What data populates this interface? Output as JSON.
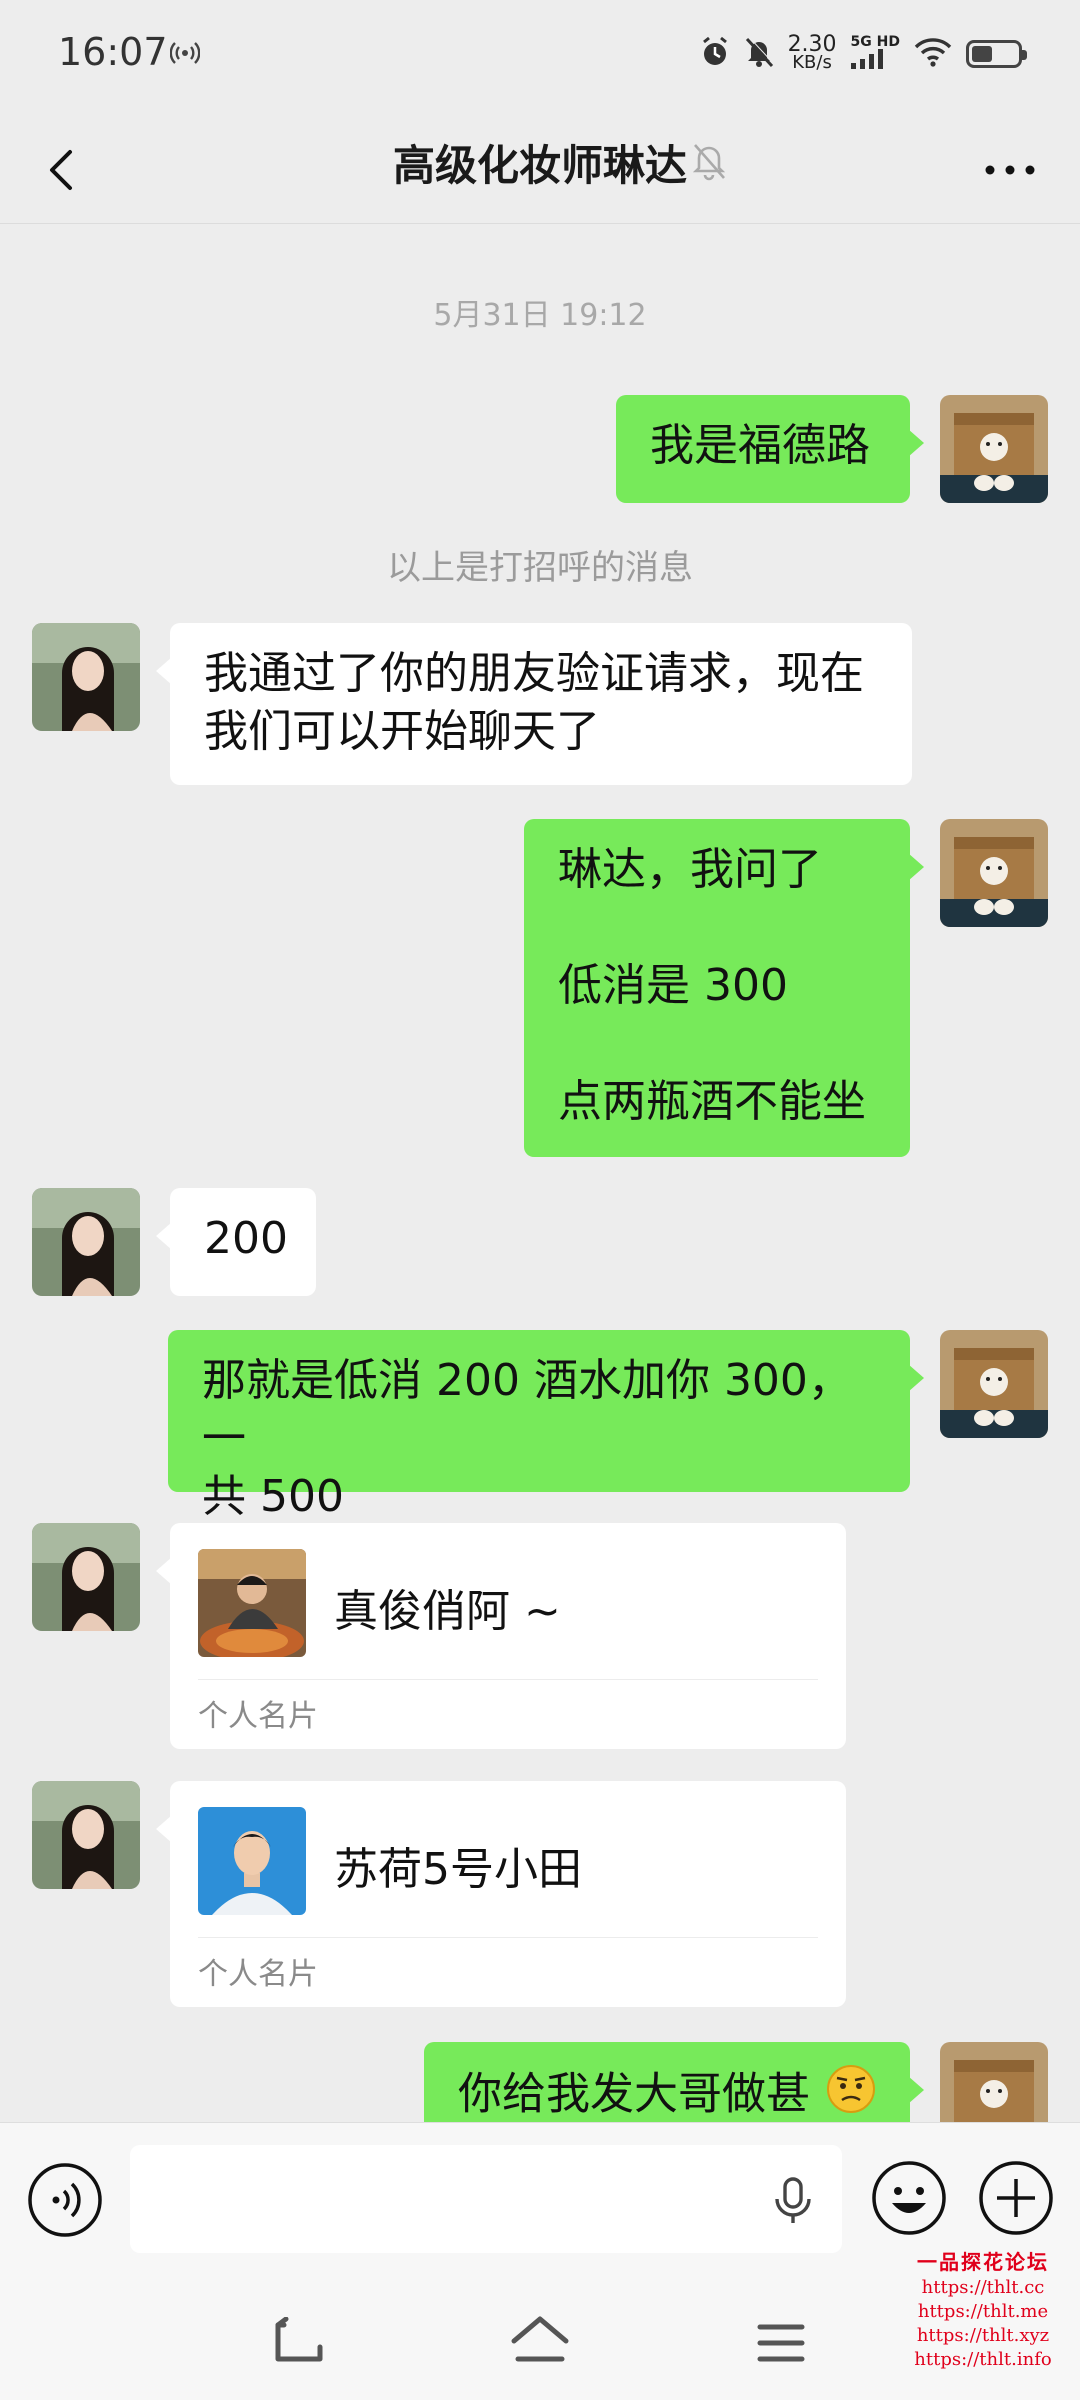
{
  "status_bar": {
    "time": "16:07",
    "net_speed_value": "2.30",
    "net_speed_unit": "KB/s",
    "network_label": "5G HD",
    "icons": [
      "hotspot-icon",
      "alarm-icon",
      "mute-bell-icon",
      "signal-icon",
      "wifi-icon",
      "battery-icon"
    ]
  },
  "header": {
    "title": "高级化妆师琳达",
    "icons": [
      "back-arrow-icon",
      "muted-bell-icon",
      "more-dots-icon"
    ]
  },
  "chat": {
    "timestamp": "5月31日 19:12",
    "system_notice": "以上是打招呼的消息",
    "messages": [
      {
        "side": "out",
        "lines": [
          "我是福德路"
        ]
      },
      {
        "side": "in",
        "lines": [
          "我通过了你的朋友验证请求，现在",
          "我们可以开始聊天了"
        ]
      },
      {
        "side": "out",
        "lines": [
          "琳达，我问了",
          "",
          "低消是 300",
          "",
          "点两瓶酒不能坐"
        ]
      },
      {
        "side": "in",
        "lines": [
          "200"
        ]
      },
      {
        "side": "out",
        "lines": [
          "那就是低消 200 酒水加你 300，一",
          "共 500"
        ]
      },
      {
        "side": "in",
        "type": "contact_card",
        "name": "真俊俏阿 ~",
        "card_label": "个人名片"
      },
      {
        "side": "in",
        "type": "contact_card",
        "name": "苏荷5号小田",
        "card_label": "个人名片"
      },
      {
        "side": "out",
        "lines": [
          "你给我发大哥做甚"
        ],
        "emoji": "confused-face"
      }
    ]
  },
  "input_bar": {
    "icons": [
      "voice-icon",
      "microphone-icon",
      "emoji-icon",
      "plus-icon"
    ],
    "text_value": ""
  },
  "system_nav": {
    "icons": [
      "nav-back-icon",
      "nav-home-icon",
      "nav-menu-icon"
    ]
  },
  "watermark": {
    "title": "一品探花论坛",
    "links": [
      "https://thlt.cc",
      "https://thlt.me",
      "https://thlt.xyz",
      "https://thlt.info"
    ]
  },
  "colors": {
    "background": "#ededed",
    "outgoing_bubble": "#77ea5a",
    "incoming_bubble": "#ffffff",
    "watermark": "#e0001b"
  }
}
